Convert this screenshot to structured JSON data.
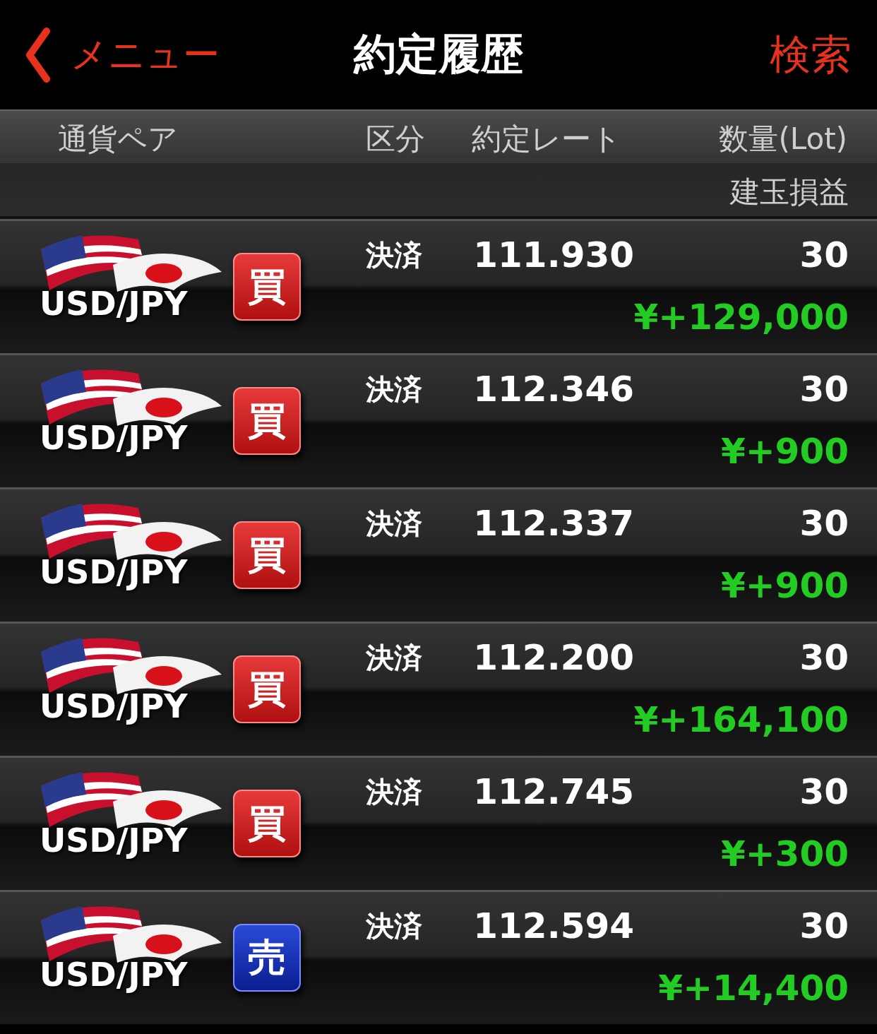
{
  "nav": {
    "back_label": "メニュー",
    "title": "約定履歴",
    "search_label": "検索"
  },
  "columns": {
    "pair": "通貨ペア",
    "type": "区分",
    "rate": "約定レート",
    "qty": "数量(Lot)",
    "pl": "建玉損益"
  },
  "rows": [
    {
      "pair": "USD/JPY",
      "kind": "buy",
      "side_label": "買",
      "type": "決済",
      "rate": "111.930",
      "qty": "30",
      "pl": "¥+129,000"
    },
    {
      "pair": "USD/JPY",
      "kind": "buy",
      "side_label": "買",
      "type": "決済",
      "rate": "112.346",
      "qty": "30",
      "pl": "¥+900"
    },
    {
      "pair": "USD/JPY",
      "kind": "buy",
      "side_label": "買",
      "type": "決済",
      "rate": "112.337",
      "qty": "30",
      "pl": "¥+900"
    },
    {
      "pair": "USD/JPY",
      "kind": "buy",
      "side_label": "買",
      "type": "決済",
      "rate": "112.200",
      "qty": "30",
      "pl": "¥+164,100"
    },
    {
      "pair": "USD/JPY",
      "kind": "buy",
      "side_label": "買",
      "type": "決済",
      "rate": "112.745",
      "qty": "30",
      "pl": "¥+300"
    },
    {
      "pair": "USD/JPY",
      "kind": "sell",
      "side_label": "売",
      "type": "決済",
      "rate": "112.594",
      "qty": "30",
      "pl": "¥+14,400"
    }
  ]
}
